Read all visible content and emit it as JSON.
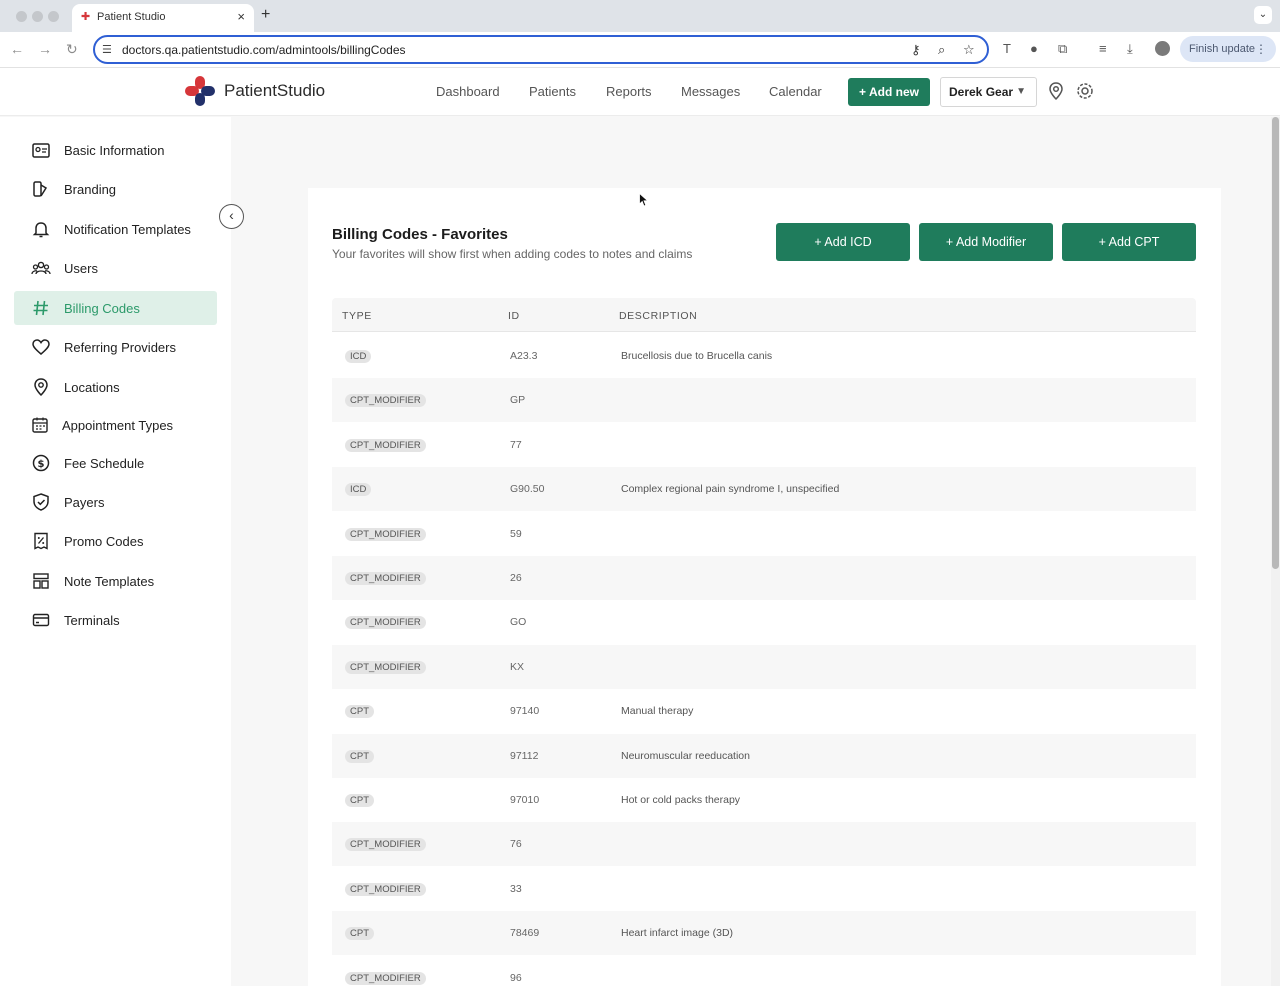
{
  "browser": {
    "tab_title": "Patient Studio",
    "url": "doctors.qa.patientstudio.com/admintools/billingCodes",
    "finish_update": "Finish update"
  },
  "header": {
    "brand": "PatientStudio",
    "nav": [
      "Dashboard",
      "Patients",
      "Reports",
      "Messages",
      "Calendar"
    ],
    "add_new": "Add new",
    "user": "Derek Gear"
  },
  "sidebar": {
    "items": [
      {
        "label": "Basic Information",
        "icon": "id-card-icon"
      },
      {
        "label": "Branding",
        "icon": "palette-icon"
      },
      {
        "label": "Notification Templates",
        "icon": "bell-icon"
      },
      {
        "label": "Users",
        "icon": "users-icon"
      },
      {
        "label": "Billing Codes",
        "icon": "hash-icon",
        "active": true
      },
      {
        "label": "Referring Providers",
        "icon": "heart-icon"
      },
      {
        "label": "Locations",
        "icon": "map-pin-icon"
      },
      {
        "label": "Appointment Types",
        "icon": "calendar-icon"
      },
      {
        "label": "Fee Schedule",
        "icon": "dollar-icon"
      },
      {
        "label": "Payers",
        "icon": "shield-icon"
      },
      {
        "label": "Promo Codes",
        "icon": "receipt-icon"
      },
      {
        "label": "Note Templates",
        "icon": "template-icon"
      },
      {
        "label": "Terminals",
        "icon": "card-terminal-icon"
      }
    ]
  },
  "main": {
    "title": "Billing Codes - Favorites",
    "subtitle": "Your favorites will show first when adding codes to notes and claims",
    "buttons": {
      "add_icd": "+ Add ICD",
      "add_modifier": "+ Add Modifier",
      "add_cpt": "+ Add CPT"
    },
    "columns": [
      "TYPE",
      "ID",
      "DESCRIPTION"
    ],
    "rows": [
      {
        "type": "ICD",
        "id": "A23.3",
        "description": "Brucellosis due to Brucella canis"
      },
      {
        "type": "CPT_MODIFIER",
        "id": "GP",
        "description": ""
      },
      {
        "type": "CPT_MODIFIER",
        "id": "77",
        "description": ""
      },
      {
        "type": "ICD",
        "id": "G90.50",
        "description": "Complex regional pain syndrome I, unspecified"
      },
      {
        "type": "CPT_MODIFIER",
        "id": "59",
        "description": ""
      },
      {
        "type": "CPT_MODIFIER",
        "id": "26",
        "description": ""
      },
      {
        "type": "CPT_MODIFIER",
        "id": "GO",
        "description": ""
      },
      {
        "type": "CPT_MODIFIER",
        "id": "KX",
        "description": ""
      },
      {
        "type": "CPT",
        "id": "97140",
        "description": "Manual therapy"
      },
      {
        "type": "CPT",
        "id": "97112",
        "description": "Neuromuscular reeducation"
      },
      {
        "type": "CPT",
        "id": "97010",
        "description": "Hot or cold packs therapy"
      },
      {
        "type": "CPT_MODIFIER",
        "id": "76",
        "description": ""
      },
      {
        "type": "CPT_MODIFIER",
        "id": "33",
        "description": ""
      },
      {
        "type": "CPT",
        "id": "78469",
        "description": "Heart infarct image (3D)"
      },
      {
        "type": "CPT_MODIFIER",
        "id": "96",
        "description": ""
      }
    ]
  },
  "colors": {
    "primary_green": "#1f7c5c",
    "active_bg": "#dff0e8",
    "active_text": "#2c9a6a"
  }
}
